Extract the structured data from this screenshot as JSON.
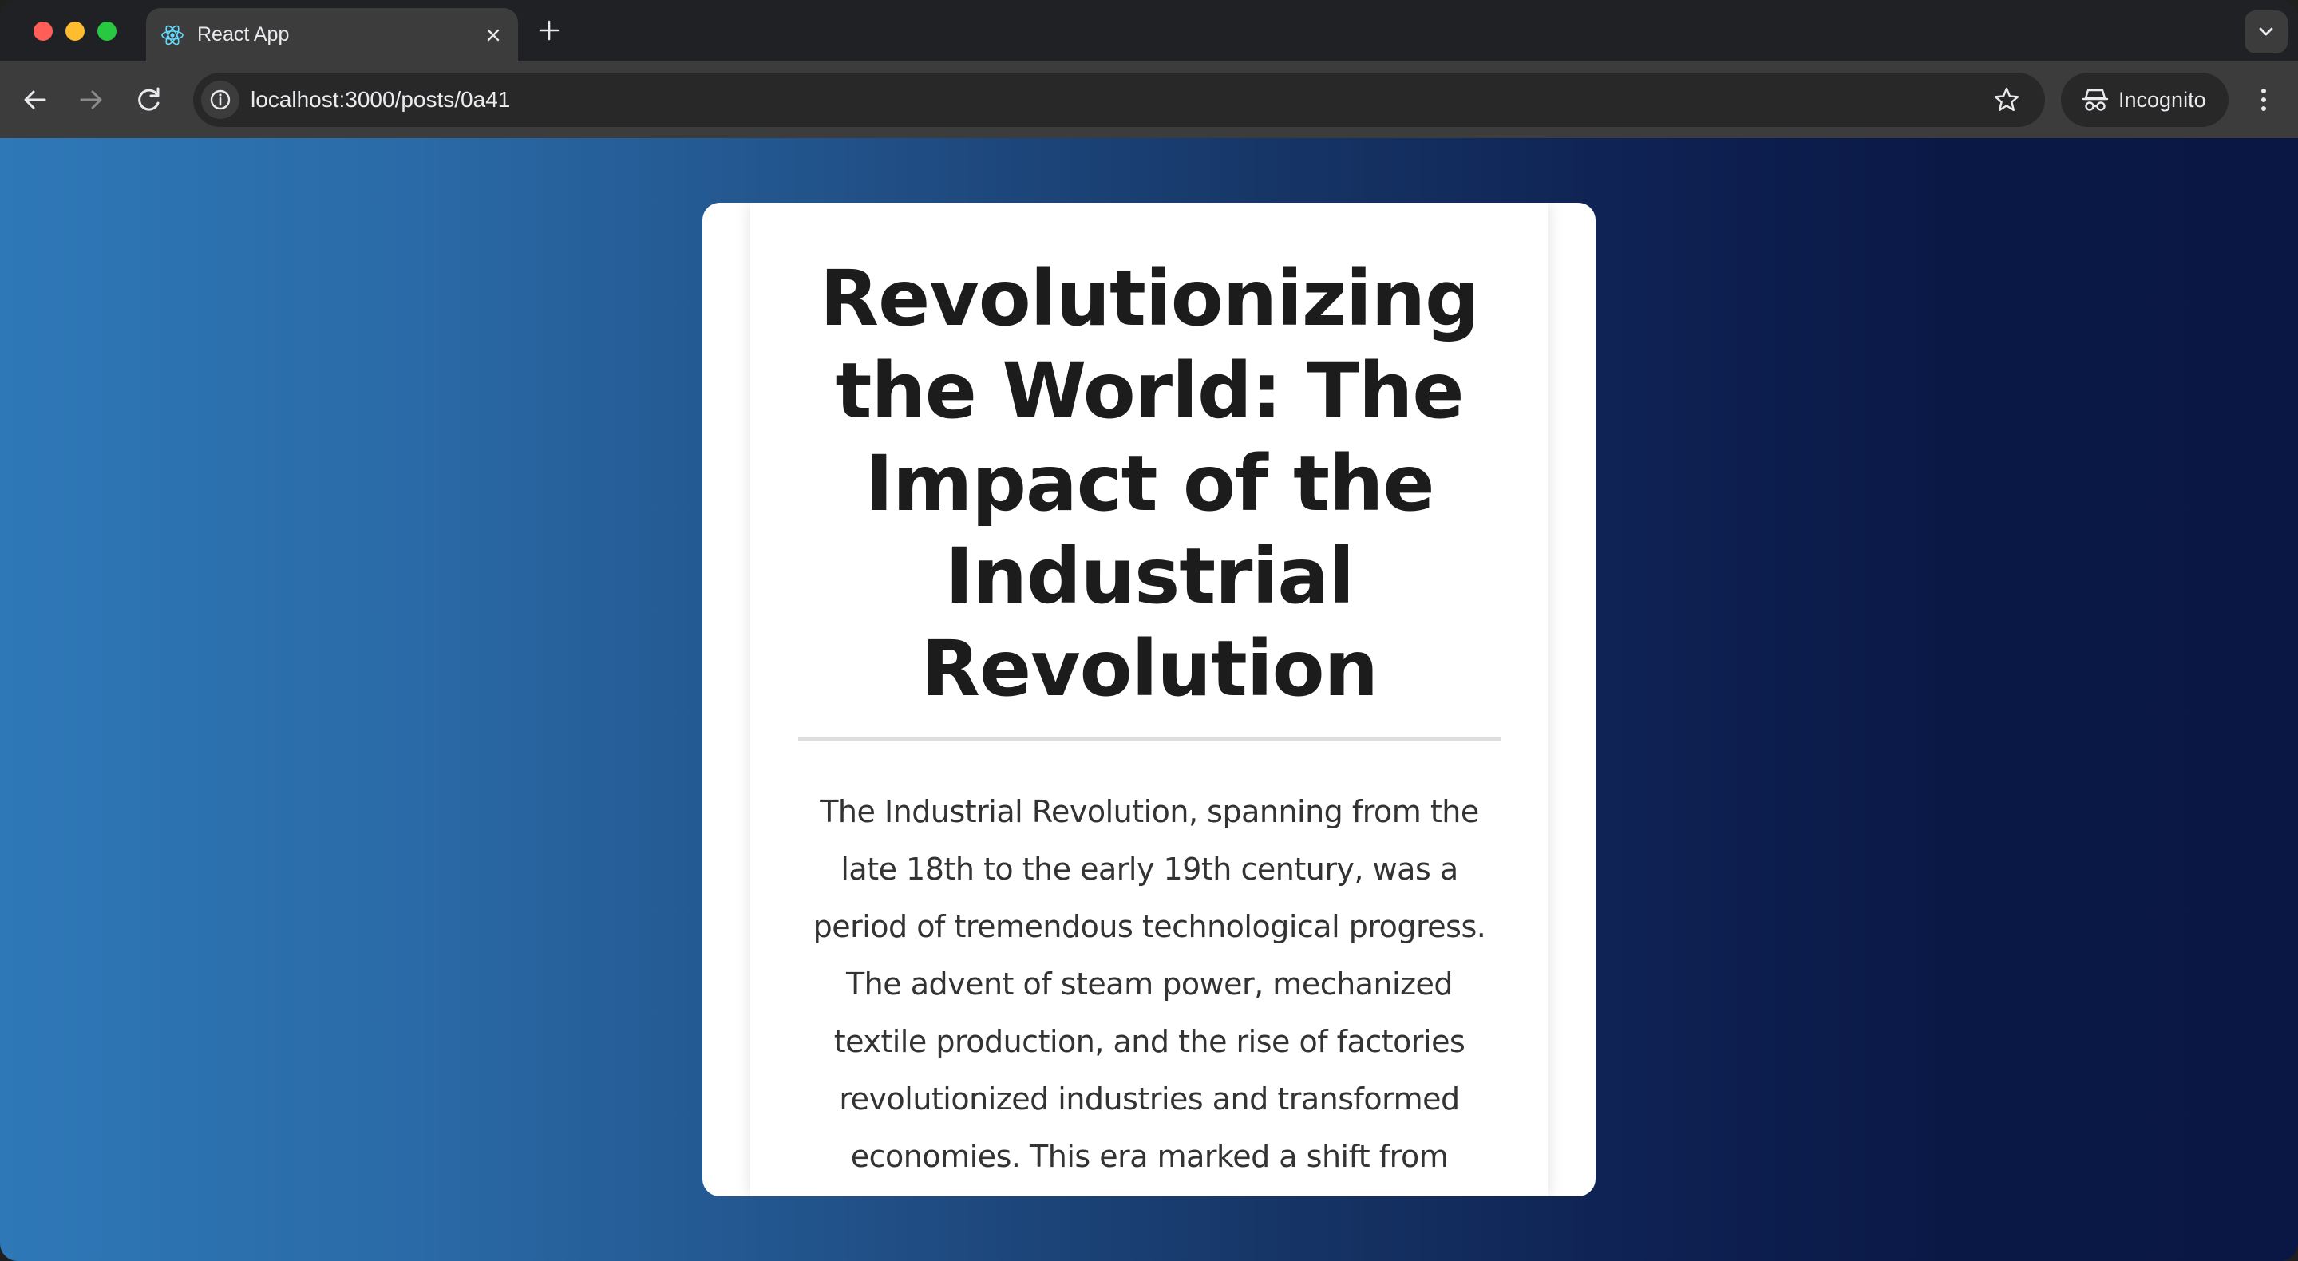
{
  "browser": {
    "tab": {
      "title": "React App",
      "favicon": "react-logo-icon"
    },
    "url": "localhost:3000/posts/0a41",
    "incognito_label": "Incognito"
  },
  "post": {
    "title": "Revolutionizing the World: The Impact of the Industrial Revolution",
    "body": "The Industrial Revolution, spanning from the late 18th to the early 19th century, was a period of tremendous technological progress. The advent of steam power, mechanized textile production, and the rise of factories revolutionized industries and transformed economies. This era marked a shift from agrarian societies to industrial"
  },
  "colors": {
    "gradient_left": "#2e78b7",
    "gradient_right": "#0a1744",
    "card_background": "#ffffff",
    "title_text": "#1c1c1c",
    "body_text": "#333333"
  }
}
